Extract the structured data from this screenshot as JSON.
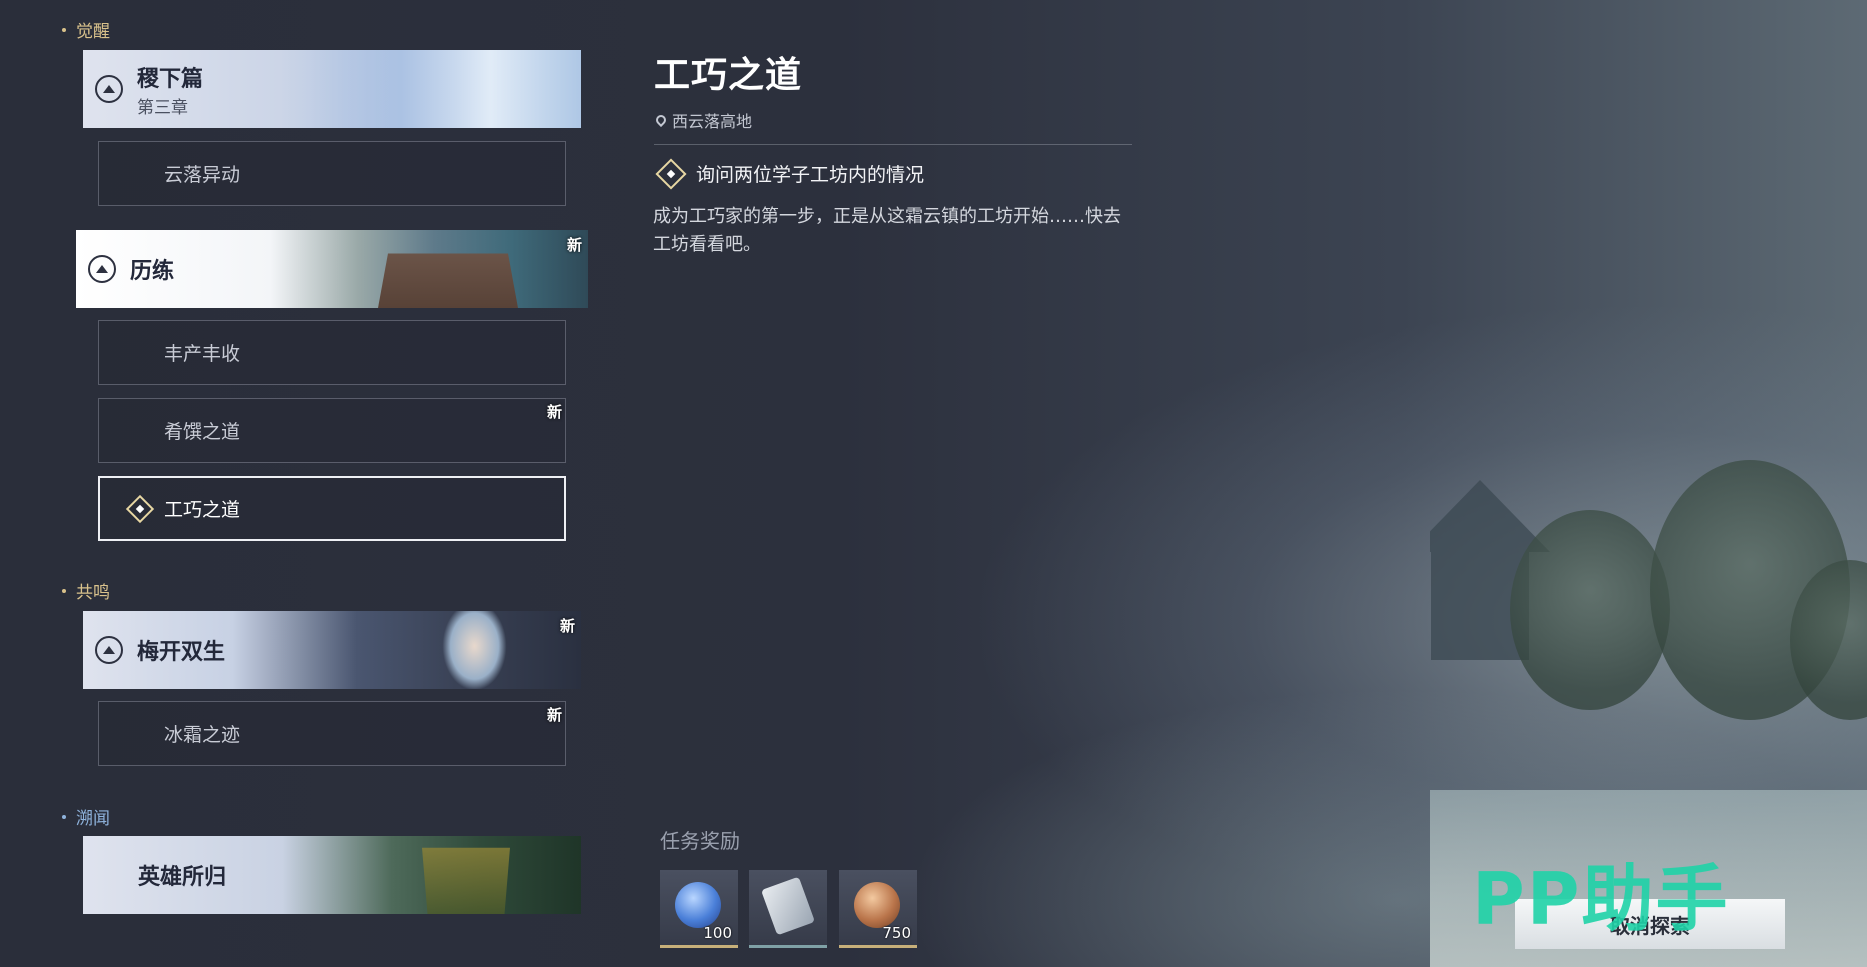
{
  "left_panel": {
    "sections": [
      {
        "label": "觉醒"
      },
      {
        "label": "共鸣"
      },
      {
        "label": "溯闻"
      }
    ],
    "chapters": [
      {
        "title": "稷下篇",
        "subtitle": "第三章"
      },
      {
        "title": "历练",
        "new_tag": "新"
      },
      {
        "title": "梅开双生",
        "new_tag": "新"
      },
      {
        "title": "英雄所归"
      }
    ],
    "quests": [
      {
        "label": "云落异动"
      },
      {
        "label": "丰产丰收"
      },
      {
        "label": "肴馔之道",
        "new_tag": "新"
      },
      {
        "label": "工巧之道"
      },
      {
        "label": "冰霜之迹",
        "new_tag": "新"
      }
    ]
  },
  "detail": {
    "title": "工巧之道",
    "location": "西云落高地",
    "objective": "询问两位学子工坊内的情况",
    "description": "成为工巧家的第一步，正是从这霜云镇的工坊开始……快去工坊看看吧。"
  },
  "rewards": {
    "title": "任务奖励",
    "items": [
      {
        "icon": "blue-coin-icon",
        "qty": "100"
      },
      {
        "icon": "scroll-icon",
        "qty": ""
      },
      {
        "icon": "bronze-coin-icon",
        "qty": "750"
      }
    ]
  },
  "actions": {
    "cancel_label": "取消探索"
  },
  "watermark": "PP助手"
}
